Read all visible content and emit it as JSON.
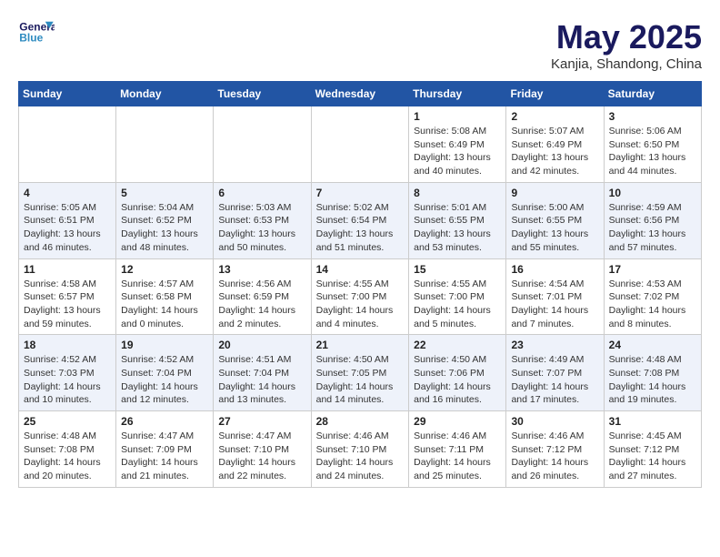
{
  "logo": {
    "line1": "General",
    "line2": "Blue"
  },
  "title": {
    "month_year": "May 2025",
    "location": "Kanjia, Shandong, China"
  },
  "weekdays": [
    "Sunday",
    "Monday",
    "Tuesday",
    "Wednesday",
    "Thursday",
    "Friday",
    "Saturday"
  ],
  "weeks": [
    [
      {
        "day": "",
        "info": ""
      },
      {
        "day": "",
        "info": ""
      },
      {
        "day": "",
        "info": ""
      },
      {
        "day": "",
        "info": ""
      },
      {
        "day": "1",
        "info": "Sunrise: 5:08 AM\nSunset: 6:49 PM\nDaylight: 13 hours\nand 40 minutes."
      },
      {
        "day": "2",
        "info": "Sunrise: 5:07 AM\nSunset: 6:49 PM\nDaylight: 13 hours\nand 42 minutes."
      },
      {
        "day": "3",
        "info": "Sunrise: 5:06 AM\nSunset: 6:50 PM\nDaylight: 13 hours\nand 44 minutes."
      }
    ],
    [
      {
        "day": "4",
        "info": "Sunrise: 5:05 AM\nSunset: 6:51 PM\nDaylight: 13 hours\nand 46 minutes."
      },
      {
        "day": "5",
        "info": "Sunrise: 5:04 AM\nSunset: 6:52 PM\nDaylight: 13 hours\nand 48 minutes."
      },
      {
        "day": "6",
        "info": "Sunrise: 5:03 AM\nSunset: 6:53 PM\nDaylight: 13 hours\nand 50 minutes."
      },
      {
        "day": "7",
        "info": "Sunrise: 5:02 AM\nSunset: 6:54 PM\nDaylight: 13 hours\nand 51 minutes."
      },
      {
        "day": "8",
        "info": "Sunrise: 5:01 AM\nSunset: 6:55 PM\nDaylight: 13 hours\nand 53 minutes."
      },
      {
        "day": "9",
        "info": "Sunrise: 5:00 AM\nSunset: 6:55 PM\nDaylight: 13 hours\nand 55 minutes."
      },
      {
        "day": "10",
        "info": "Sunrise: 4:59 AM\nSunset: 6:56 PM\nDaylight: 13 hours\nand 57 minutes."
      }
    ],
    [
      {
        "day": "11",
        "info": "Sunrise: 4:58 AM\nSunset: 6:57 PM\nDaylight: 13 hours\nand 59 minutes."
      },
      {
        "day": "12",
        "info": "Sunrise: 4:57 AM\nSunset: 6:58 PM\nDaylight: 14 hours\nand 0 minutes."
      },
      {
        "day": "13",
        "info": "Sunrise: 4:56 AM\nSunset: 6:59 PM\nDaylight: 14 hours\nand 2 minutes."
      },
      {
        "day": "14",
        "info": "Sunrise: 4:55 AM\nSunset: 7:00 PM\nDaylight: 14 hours\nand 4 minutes."
      },
      {
        "day": "15",
        "info": "Sunrise: 4:55 AM\nSunset: 7:00 PM\nDaylight: 14 hours\nand 5 minutes."
      },
      {
        "day": "16",
        "info": "Sunrise: 4:54 AM\nSunset: 7:01 PM\nDaylight: 14 hours\nand 7 minutes."
      },
      {
        "day": "17",
        "info": "Sunrise: 4:53 AM\nSunset: 7:02 PM\nDaylight: 14 hours\nand 8 minutes."
      }
    ],
    [
      {
        "day": "18",
        "info": "Sunrise: 4:52 AM\nSunset: 7:03 PM\nDaylight: 14 hours\nand 10 minutes."
      },
      {
        "day": "19",
        "info": "Sunrise: 4:52 AM\nSunset: 7:04 PM\nDaylight: 14 hours\nand 12 minutes."
      },
      {
        "day": "20",
        "info": "Sunrise: 4:51 AM\nSunset: 7:04 PM\nDaylight: 14 hours\nand 13 minutes."
      },
      {
        "day": "21",
        "info": "Sunrise: 4:50 AM\nSunset: 7:05 PM\nDaylight: 14 hours\nand 14 minutes."
      },
      {
        "day": "22",
        "info": "Sunrise: 4:50 AM\nSunset: 7:06 PM\nDaylight: 14 hours\nand 16 minutes."
      },
      {
        "day": "23",
        "info": "Sunrise: 4:49 AM\nSunset: 7:07 PM\nDaylight: 14 hours\nand 17 minutes."
      },
      {
        "day": "24",
        "info": "Sunrise: 4:48 AM\nSunset: 7:08 PM\nDaylight: 14 hours\nand 19 minutes."
      }
    ],
    [
      {
        "day": "25",
        "info": "Sunrise: 4:48 AM\nSunset: 7:08 PM\nDaylight: 14 hours\nand 20 minutes."
      },
      {
        "day": "26",
        "info": "Sunrise: 4:47 AM\nSunset: 7:09 PM\nDaylight: 14 hours\nand 21 minutes."
      },
      {
        "day": "27",
        "info": "Sunrise: 4:47 AM\nSunset: 7:10 PM\nDaylight: 14 hours\nand 22 minutes."
      },
      {
        "day": "28",
        "info": "Sunrise: 4:46 AM\nSunset: 7:10 PM\nDaylight: 14 hours\nand 24 minutes."
      },
      {
        "day": "29",
        "info": "Sunrise: 4:46 AM\nSunset: 7:11 PM\nDaylight: 14 hours\nand 25 minutes."
      },
      {
        "day": "30",
        "info": "Sunrise: 4:46 AM\nSunset: 7:12 PM\nDaylight: 14 hours\nand 26 minutes."
      },
      {
        "day": "31",
        "info": "Sunrise: 4:45 AM\nSunset: 7:12 PM\nDaylight: 14 hours\nand 27 minutes."
      }
    ]
  ]
}
